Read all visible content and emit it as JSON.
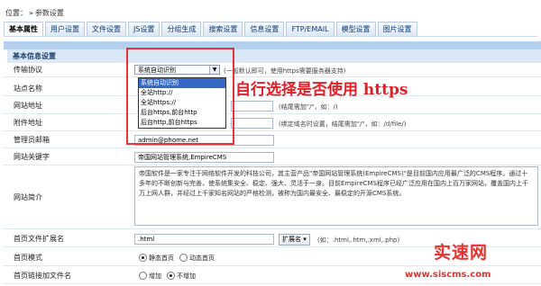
{
  "breadcrumb": {
    "prefix": "位置：",
    "item": "参数设置"
  },
  "tabs": [
    "基本属性",
    "用户设置",
    "文件设置",
    "JS设置",
    "分组生成",
    "搜索设置",
    "信息设置",
    "FTP/EMAIL",
    "模型设置",
    "图片设置"
  ],
  "section_title": "基本信息设置",
  "rows": {
    "protocol": {
      "label": "传输协议",
      "value": "系统自动识别",
      "note": "(一般默认即可，使用https需要服务器支持)"
    },
    "site_name": {
      "label": "站点名称"
    },
    "site_url": {
      "label": "网站地址",
      "note": "(结尾需加\"/\"，如：/)"
    },
    "attach_url": {
      "label": "附件地址",
      "note": "(绑定域名时设置，结尾需加\"/\"，如：/d/file/)"
    },
    "admin_email": {
      "label": "管理员邮箱",
      "value": "admin@phome.net"
    },
    "keywords": {
      "label": "网站关键字",
      "value": "帝国网站管理系统,EmpireCMS"
    },
    "intro": {
      "label": "网站简介",
      "value": "帝国软件是一家专注于网络软件开发的科技公司，其主营产品\"帝国网站管理系统(EmpireCMS)\"是目前国内应用最广泛的CMS程序。通过十多年的不断创新与完善，使系统集安全、稳定、强大、灵活于一身。目前EmpireCMS程序已经广泛应用在国内上百万家网站，覆盖国内上千万上网人群，并经过上千家知名网站的严格检测，被称为国内最安全、最稳定的开源CMS系统。"
    },
    "index_ext": {
      "label": "首页文件扩展名",
      "value": ".html",
      "button": "扩展名",
      "note": "(如：.html,.htm,.xml,.php)"
    },
    "index_mode": {
      "label": "首页模式",
      "options": [
        "静态首页",
        "动态首页"
      ],
      "selected": 0
    },
    "index_link": {
      "label": "首页链接加文件名",
      "options": [
        "增加",
        "不增加"
      ],
      "selected": 1
    }
  },
  "dropdown_options": [
    "系统自动识别",
    "全站http://",
    "全站https://",
    "后台https,前台http",
    "后台http,前台https"
  ],
  "dropdown_selected": 0,
  "annotation": "自行选择是否使用 https",
  "watermark": {
    "cn": "实速网",
    "url": "www.siscms.com"
  },
  "colors": {
    "accent": "#e8323a",
    "header_bg": "#dbe8f7",
    "selected": "#3368c6"
  }
}
